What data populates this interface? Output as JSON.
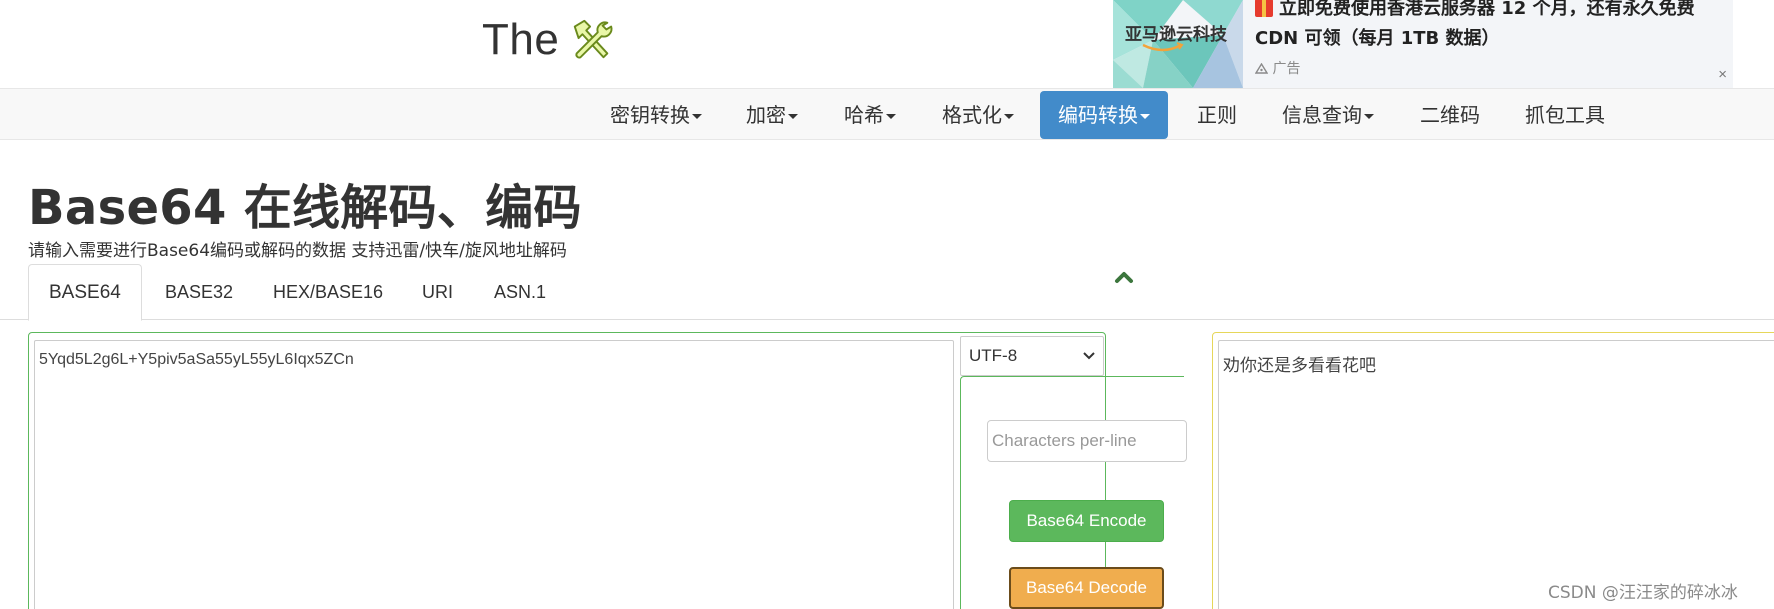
{
  "header": {
    "logo_text": "The",
    "logo_icon": "tools-icon"
  },
  "ad": {
    "brand": "亚马逊云科技",
    "headline": "立即免费使用香港云服务器 12 个月，还有永久免费 CDN 可领（每月 1TB 数据）",
    "label": "广告",
    "close": "×"
  },
  "nav": {
    "items": [
      {
        "label": "密钥转换",
        "dropdown": true
      },
      {
        "label": "加密",
        "dropdown": true
      },
      {
        "label": "哈希",
        "dropdown": true
      },
      {
        "label": "格式化",
        "dropdown": true
      },
      {
        "label": "编码转换",
        "dropdown": true,
        "active": true
      },
      {
        "label": "正则",
        "dropdown": false
      },
      {
        "label": "信息查询",
        "dropdown": true
      },
      {
        "label": "二维码",
        "dropdown": false
      },
      {
        "label": "抓包工具",
        "dropdown": false
      }
    ],
    "active_color": "#428bca"
  },
  "page": {
    "title": "Base64 在线解码、编码",
    "description": "请输入需要进行Base64编码或解码的数据 支持迅雷/快车/旋风地址解码"
  },
  "tabs": [
    {
      "label": "BASE64",
      "active": true
    },
    {
      "label": "BASE32"
    },
    {
      "label": "HEX/BASE16"
    },
    {
      "label": "URI"
    },
    {
      "label": "ASN.1"
    }
  ],
  "encoder": {
    "input_value": "5Yqd5L2g6L+Y5piv5aSa55yL55yL6Iqx5ZCn",
    "charset": "UTF-8",
    "chars_per_line_placeholder": "Characters per-line",
    "encode_label": "Base64 Encode",
    "decode_label": "Base64 Decode",
    "output_value": "劝你还是多看看花吧"
  },
  "colors": {
    "success": "#5cb85c",
    "warning": "#f0ad4e",
    "output_border": "#e6d75a"
  },
  "watermark": "CSDN @汪汪家的碎冰冰"
}
